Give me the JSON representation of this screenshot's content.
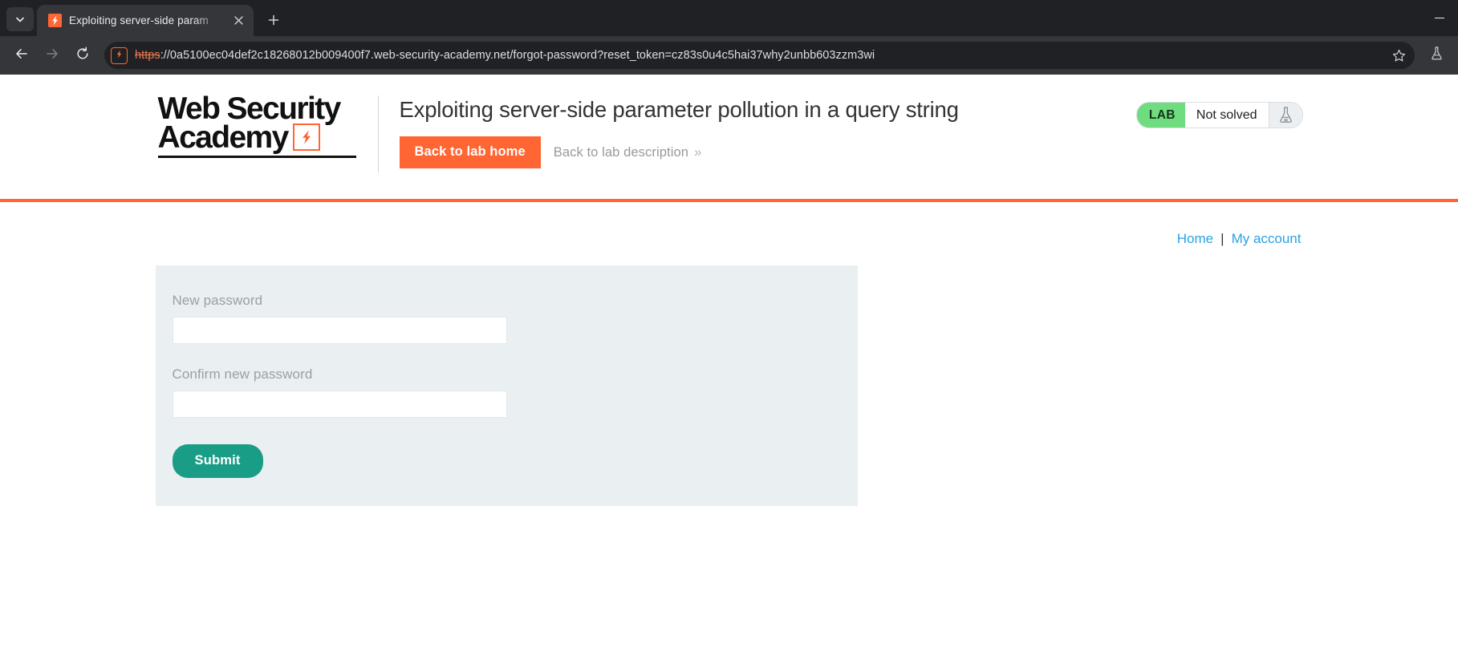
{
  "browser": {
    "tab": {
      "title": "Exploiting server-side param",
      "favicon_icon": "burp-lightning-icon",
      "close_icon": "close-icon"
    },
    "tab_list_icon": "chevron-down-icon",
    "new_tab_icon": "plus-icon",
    "window": {
      "minimize_icon": "minimize-icon"
    },
    "toolbar": {
      "back_icon": "arrow-left-icon",
      "forward_icon": "arrow-right-icon",
      "reload_icon": "reload-icon",
      "bookmark_icon": "star-icon",
      "burp_icon": "flask-icon"
    },
    "omnibox": {
      "site_chip_icon": "burp-lightning-icon",
      "url_scheme": "https",
      "url_rest": "://0a5100ec04def2c18268012b009400f7.web-security-academy.net/forgot-password?reset_token=cz83s0u4c5hai37why2unbb603zzm3wi",
      "full_url": "https://0a5100ec04def2c18268012b009400f7.web-security-academy.net/forgot-password?reset_token=cz83s0u4c5hai37why2unbb603zzm3wi"
    }
  },
  "header": {
    "logo_line1": "Web Security",
    "logo_line2": "Academy",
    "logo_mark_icon": "burp-lightning-icon",
    "lab_title": "Exploiting server-side parameter pollution in a query string",
    "back_to_lab_home": "Back to lab home",
    "back_to_lab_description": "Back to lab description",
    "back_to_lab_description_chevron": "»",
    "status": {
      "tag": "LAB",
      "state": "Not solved",
      "flask_icon": "flask-icon",
      "tag_color": "#6fdc7f"
    },
    "rule_color": "#ff6633"
  },
  "account_nav": {
    "home": "Home",
    "separator": "|",
    "my_account": "My account"
  },
  "form": {
    "new_password": {
      "label": "New password",
      "value": "",
      "placeholder": ""
    },
    "confirm_password": {
      "label": "Confirm new password",
      "value": "",
      "placeholder": ""
    },
    "submit_label": "Submit",
    "submit_color": "#199d86",
    "panel_color": "#eaeff1"
  }
}
